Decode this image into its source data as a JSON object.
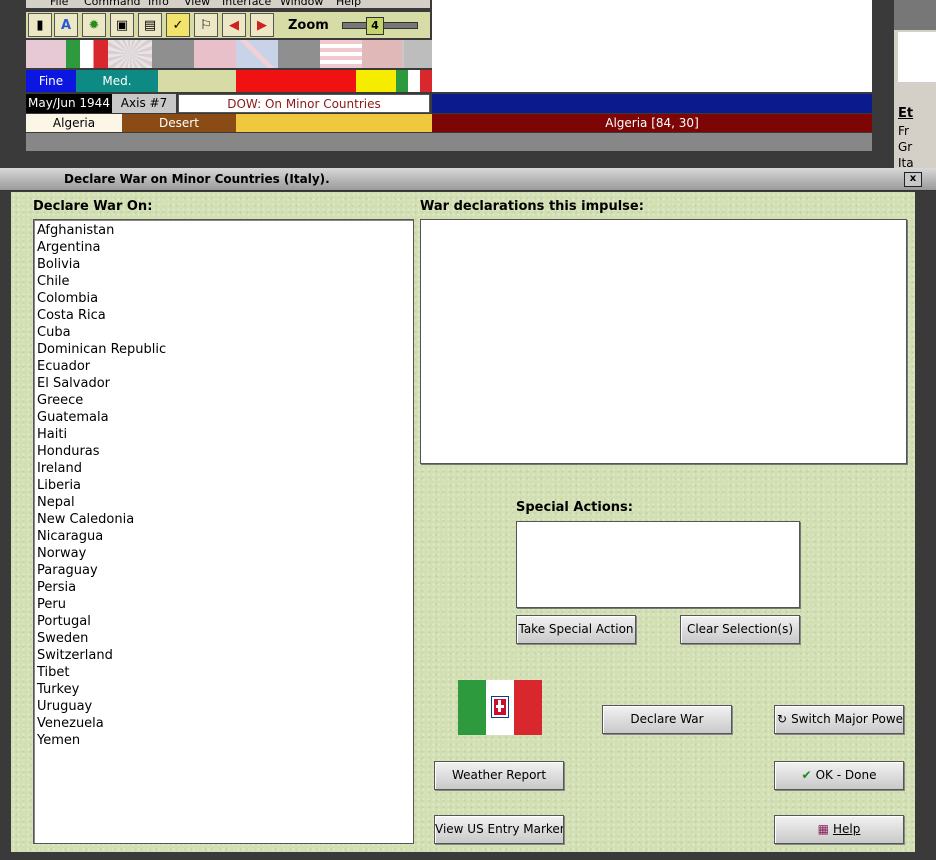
{
  "menu": [
    "File",
    "Command",
    "Info",
    "View",
    "Interface",
    "Window",
    "Help"
  ],
  "toolbar": {
    "zoom_label": "Zoom",
    "zoom_value": "4"
  },
  "status": {
    "weather1": "Fine",
    "weather2": "Med.",
    "date": "May/Jun 1944",
    "impulse": "Axis #7",
    "phase": "DOW: On Minor Countries",
    "terrain_region": "Algeria",
    "terrain_type": "Desert",
    "location": "Algeria [84, 30]"
  },
  "right_panel": {
    "title": "Et",
    "lines": [
      "Fr",
      "Gr",
      "Ita"
    ]
  },
  "dialog": {
    "title": "Declare War on Minor Countries (Italy).",
    "declare_header": "Declare War On:",
    "war_header": "War declarations this impulse:",
    "special_header": "Special Actions:",
    "countries": [
      "Afghanistan",
      "Argentina",
      "Bolivia",
      "Chile",
      "Colombia",
      "Costa Rica",
      "Cuba",
      "Dominican Republic",
      "Ecuador",
      "El Salvador",
      "Greece",
      "Guatemala",
      "Haiti",
      "Honduras",
      "Ireland",
      "Liberia",
      "Nepal",
      "New Caledonia",
      "Nicaragua",
      "Norway",
      "Paraguay",
      "Persia",
      "Peru",
      "Portugal",
      "Sweden",
      "Switzerland",
      "Tibet",
      "Turkey",
      "Uruguay",
      "Venezuela",
      "Yemen"
    ],
    "buttons": {
      "take_special": "Take Special Action",
      "clear_selection": "Clear Selection(s)",
      "declare_war": "Declare War",
      "switch_power": "Switch Major Power",
      "weather_report": "Weather Report",
      "ok_done": "OK - Done",
      "view_us": "View US Entry Markers",
      "help": "Help"
    }
  },
  "colors": {
    "italy_green": "#2e9a3e",
    "italy_red": "#d8272d",
    "panel_bg": "#d2dfb2"
  }
}
